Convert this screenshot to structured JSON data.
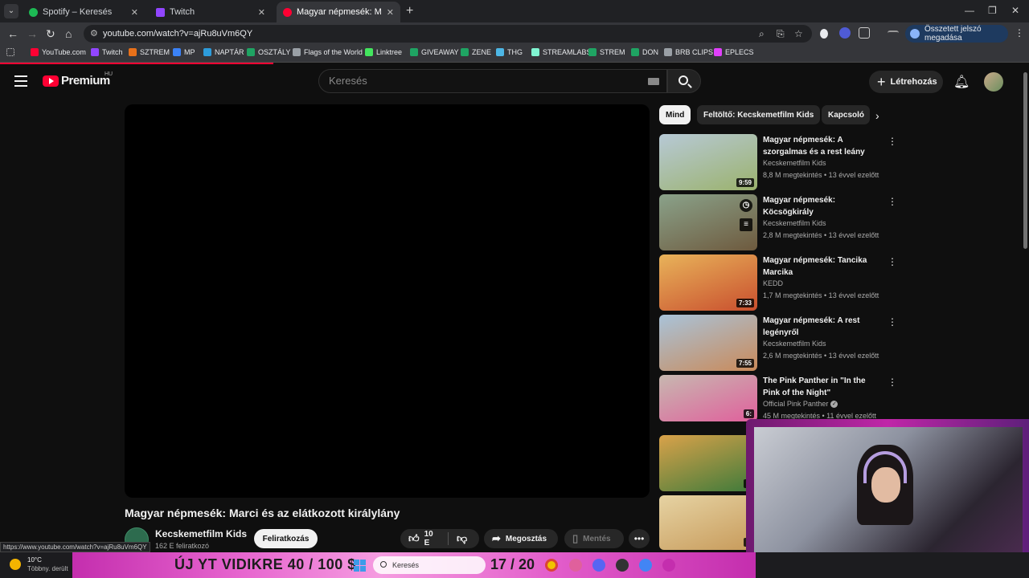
{
  "browser": {
    "tabs": [
      {
        "title": "Spotify – Keresés",
        "favicon_color": "#1db954",
        "active": false
      },
      {
        "title": "Twitch",
        "favicon_color": "#9146ff",
        "active": false
      },
      {
        "title": "Magyar népmesék: Marci és az",
        "favicon_color": "#ff0033",
        "active": true
      }
    ],
    "url": "youtube.com/watch?v=ajRu8uVm6QY",
    "password_pill": "Összetett jelszó megadása",
    "bookmarks": [
      {
        "label": "YouTube.com",
        "color": "#ff0033"
      },
      {
        "label": "Twitch",
        "color": "#9146ff"
      },
      {
        "label": "SZTREM",
        "color": "#e8711a"
      },
      {
        "label": "MP",
        "color": "#3b82f6"
      },
      {
        "label": "NAPTÁR",
        "color": "#2d9cdb"
      },
      {
        "label": "OSZTÁLY",
        "color": "#1fa463"
      },
      {
        "label": "Flags of the World",
        "color": "#9aa0a6"
      },
      {
        "label": "Linktree",
        "color": "#43e55e"
      },
      {
        "label": "GIVEAWAY",
        "color": "#1fa463"
      },
      {
        "label": "ZENE",
        "color": "#1fa463"
      },
      {
        "label": "THG",
        "color": "#4db6e5"
      },
      {
        "label": "STREAMLABS",
        "color": "#80f5d2"
      },
      {
        "label": "STREM",
        "color": "#1fa463"
      },
      {
        "label": "DON",
        "color": "#1fa463"
      },
      {
        "label": "BRB CLIPS",
        "color": "#9aa0a6"
      },
      {
        "label": "EPLECS",
        "color": "#e040fb"
      }
    ]
  },
  "yt": {
    "logo_text": "Premium",
    "region": "HU",
    "search_placeholder": "Keresés",
    "create_label": "Létrehozás"
  },
  "video": {
    "title": "Magyar népmesék: Marci és az elátkozott királylány",
    "channel": "Kecskemetfilm Kids",
    "subscribers": "162 E feliratkozó",
    "subscribe_label": "Feliratkozás",
    "likes": "10 E",
    "share_label": "Megosztás",
    "save_label": "Mentés"
  },
  "chips": [
    "Mind",
    "Feltöltő: Kecskemetfilm Kids",
    "Kapcsoló"
  ],
  "recommendations": [
    {
      "title": "Magyar népmesék: A szorgalmas és a rest leány",
      "channel": "Kecskemetfilm Kids",
      "meta": "8,8 M megtekintés • 13 évvel ezelőtt",
      "duration": "9:59",
      "colors": [
        "#b7c9d6",
        "#9bb26d"
      ]
    },
    {
      "title": "Magyar népmesék: Köcsögkirály",
      "channel": "Kecskemetfilm Kids",
      "meta": "2,8 M megtekintés • 13 évvel ezelőtt",
      "duration": "",
      "colors": [
        "#8aa28a",
        "#6e5a3e"
      ]
    },
    {
      "title": "Magyar népmesék: Tancika Marcika",
      "channel": "KEDD",
      "meta": "1,7 M megtekintés • 13 évvel ezelőtt",
      "duration": "7:33",
      "colors": [
        "#e8b35a",
        "#c94f2e"
      ]
    },
    {
      "title": "Magyar népmesék: A rest legényről",
      "channel": "Kecskemetfilm Kids",
      "meta": "2,6 M megtekintés • 13 évvel ezelőtt",
      "duration": "7:55",
      "colors": [
        "#a9c3d9",
        "#c98a5a"
      ]
    },
    {
      "title": "The Pink Panther in \"In the Pink of the Night\"",
      "channel": "Official Pink Panther",
      "meta": "45 M megtekintés • 11 évvel ezelőtt",
      "duration": "6:",
      "colors": [
        "#c7b8b0",
        "#e0609c"
      ]
    },
    {
      "title": "",
      "channel": "",
      "meta": "",
      "duration": "7:",
      "colors": [
        "#d9a24a",
        "#3d7a3a"
      ]
    },
    {
      "title": "",
      "channel": "",
      "meta": "",
      "duration": "7:",
      "colors": [
        "#e6d3a3",
        "#c79a5a"
      ]
    }
  ],
  "status_url": "https://www.youtube.com/watch?v=ajRu8uVm6QY",
  "taskbar": {
    "weather_temp": "10°C",
    "weather_desc": "Többny. derült",
    "banner_text": "ÚJ YT VIDIKRE  40 / 100 $",
    "banner_count": "17 / 20",
    "search_label": "Keresés"
  }
}
